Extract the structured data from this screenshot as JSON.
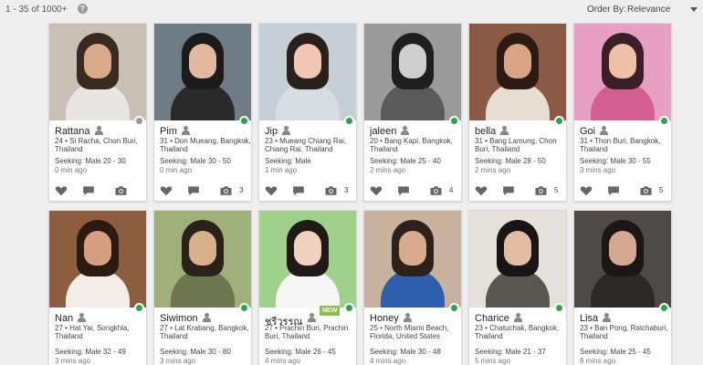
{
  "header": {
    "result_count": "1 - 35 of 1000+",
    "help_icon": "?",
    "order_label": "Order By:",
    "order_value": "Relevance"
  },
  "colors": {
    "online": "#2aa64a",
    "offline": "#999999",
    "new_badge": "#8ac04a",
    "icon_grey": "#666666"
  },
  "profiles": [
    {
      "name": "Rattana",
      "location": "24 • Si Racha, Chon Buri, Thailand",
      "seeking": "Seeking: Male 20 - 30",
      "time": "0 min ago",
      "photos": "",
      "online": false,
      "new": false,
      "bg": "#c9c0b5",
      "hair": "#3a2b22",
      "skin": "#d9a98a",
      "outfit": "#e8e5e2"
    },
    {
      "name": "Pim",
      "location": "31 • Don Mueang, Bangkok, Thailand",
      "seeking": "Seeking: Male 30 - 50",
      "time": "0 min ago",
      "photos": "3",
      "online": true,
      "new": false,
      "bg": "#6e7c86",
      "hair": "#1d1a1a",
      "skin": "#e2b9a0",
      "outfit": "#2a2a2a"
    },
    {
      "name": "Jip",
      "location": "23 • Mueang Chiang Rai, Chiang Rai, Thailand",
      "seeking": "Seeking: Male",
      "time": "1 min ago",
      "photos": "3",
      "online": true,
      "new": false,
      "bg": "#c6cfd6",
      "hair": "#2b211c",
      "skin": "#f1c7b4",
      "outfit": "#d7dde2"
    },
    {
      "name": "jaleen",
      "location": "20 • Bang Kapi, Bangkok, Thailand",
      "seeking": "Seeking: Male 25 - 40",
      "time": "2 mins ago",
      "photos": "4",
      "online": true,
      "new": false,
      "bg": "#9a9a9a",
      "hair": "#1e1e1e",
      "skin": "#cfcfcf",
      "outfit": "#5a5a5a"
    },
    {
      "name": "bella",
      "location": "31 • Bang Lamung, Chon Buri, Thailand",
      "seeking": "Seeking: Male 28 - 50",
      "time": "2 mins ago",
      "photos": "5",
      "online": true,
      "new": false,
      "bg": "#8a5a44",
      "hair": "#2c1b13",
      "skin": "#d8a485",
      "outfit": "#e6ddd3"
    },
    {
      "name": "Goi",
      "location": "31 • Thon Buri, Bangkok, Thailand",
      "seeking": "Seeking: Male 30 - 55",
      "time": "3 mins ago",
      "photos": "5",
      "online": true,
      "new": false,
      "bg": "#e79fc2",
      "hair": "#3a1f27",
      "skin": "#efc0a8",
      "outfit": "#d25f8f"
    },
    {
      "name": "Nan",
      "location": "27 • Hat Yai, Songkhla, Thailand",
      "seeking": "Seeking: Male 32 - 49",
      "time": "3 mins ago",
      "photos": "",
      "online": true,
      "new": false,
      "bg": "#8c5d3f",
      "hair": "#2a1a12",
      "skin": "#d6a080",
      "outfit": "#f2ede8"
    },
    {
      "name": "Siwimon",
      "location": "27 • Lat Krabang, Bangkok, Thailand",
      "seeking": "Seeking: Male 30 - 80",
      "time": "3 mins ago",
      "photos": "",
      "online": true,
      "new": false,
      "bg": "#9fb07a",
      "hair": "#2a221a",
      "skin": "#d7b08e",
      "outfit": "#6d7650"
    },
    {
      "name": "ชรีวรรณ",
      "location": "27 • Prachin Buri, Prachin Buri, Thailand",
      "seeking": "Seeking: Male 26 - 45",
      "time": "4 mins ago",
      "photos": "",
      "online": true,
      "new": true,
      "new_label": "NEW",
      "bg": "#9fd08c",
      "hair": "#1f1a17",
      "skin": "#f0d1bd",
      "outfit": "#f6f6f6"
    },
    {
      "name": "Honey",
      "location": "25 • North Miami Beach, Florida, United States",
      "seeking": "Seeking: Male 30 - 48",
      "time": "4 mins ago",
      "photos": "",
      "online": true,
      "new": false,
      "bg": "#c9b2a0",
      "hair": "#2d211b",
      "skin": "#d8ab8c",
      "outfit": "#2e5fae"
    },
    {
      "name": "Charice",
      "location": "23 • Chatuchak, Bangkok, Thailand",
      "seeking": "Seeking: Male 21 - 37",
      "time": "5 mins ago",
      "photos": "",
      "online": true,
      "new": false,
      "bg": "#e4e0dc",
      "hair": "#1a1515",
      "skin": "#e3bca3",
      "outfit": "#5a5650"
    },
    {
      "name": "Lisa",
      "location": "23 • Ban Pong, Ratchaburi, Thailand",
      "seeking": "Seeking: Male 25 - 45",
      "time": "8 mins ago",
      "photos": "",
      "online": true,
      "new": false,
      "bg": "#4e4a47",
      "hair": "#1c1716",
      "skin": "#d6a68e",
      "outfit": "#2b2828"
    }
  ]
}
